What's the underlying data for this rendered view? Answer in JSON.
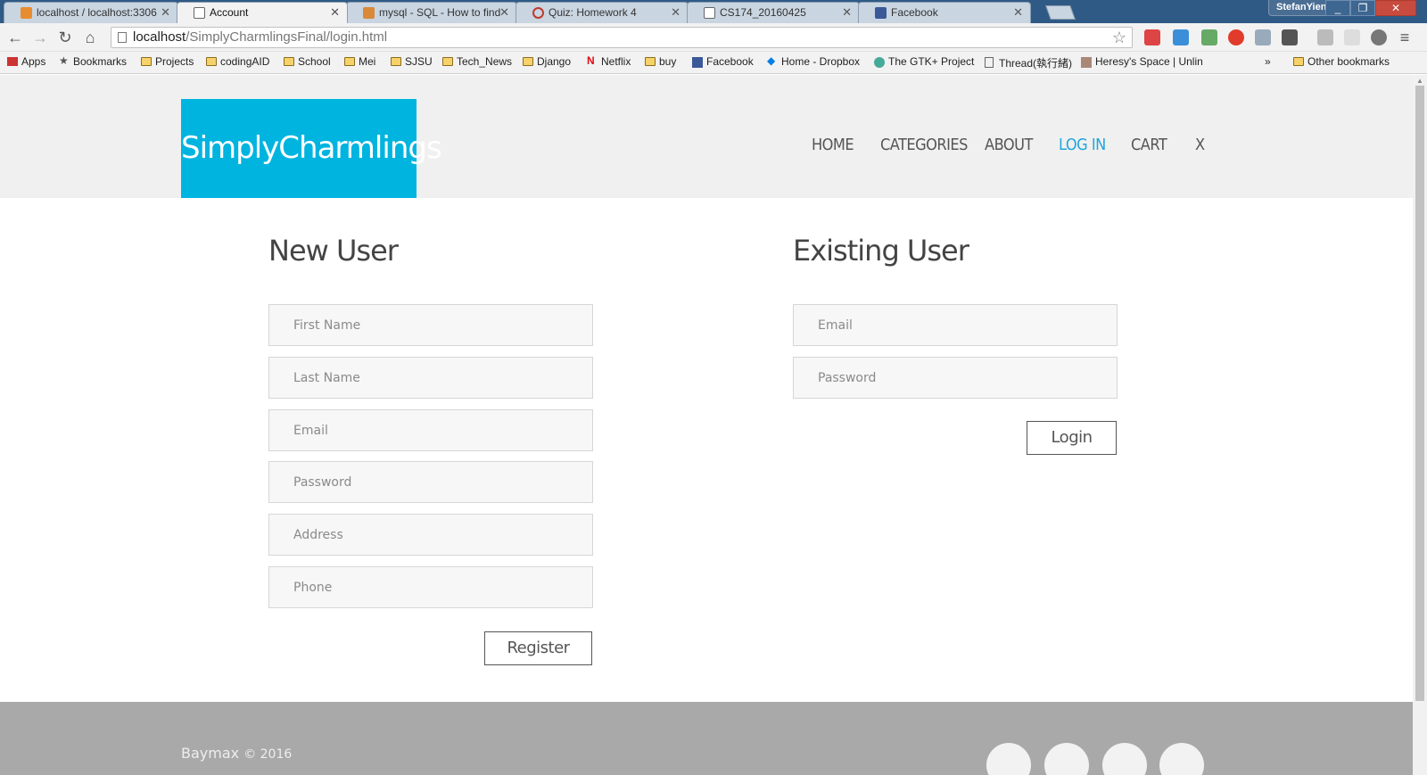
{
  "browser": {
    "tabs": [
      {
        "title": "localhost / localhost:3306"
      },
      {
        "title": "Account"
      },
      {
        "title": "mysql - SQL - How to find"
      },
      {
        "title": "Quiz: Homework 4"
      },
      {
        "title": "CS174_20160425"
      },
      {
        "title": "Facebook"
      }
    ],
    "profile_name": "StefanYien",
    "url_host": "localhost",
    "url_path": "/SimplyCharmlingsFinal/login.html",
    "bookmarks": [
      {
        "label": "Apps"
      },
      {
        "label": "Bookmarks"
      },
      {
        "label": "Projects"
      },
      {
        "label": "codingAID"
      },
      {
        "label": "School"
      },
      {
        "label": "Mei"
      },
      {
        "label": "SJSU"
      },
      {
        "label": "Tech_News"
      },
      {
        "label": "Django"
      },
      {
        "label": "Netflix"
      },
      {
        "label": "buy"
      },
      {
        "label": "Facebook"
      },
      {
        "label": "Home - Dropbox"
      },
      {
        "label": "The GTK+ Project"
      },
      {
        "label": "Thread(執行緒)"
      },
      {
        "label": "Heresy's Space | Unlin"
      }
    ],
    "overflow_chevron": "»",
    "other_bookmarks": "Other bookmarks"
  },
  "site": {
    "logo": "SimplyCharmlings",
    "nav": [
      "HOME",
      "CATEGORIES",
      "ABOUT",
      "LOG IN",
      "CART",
      "X"
    ],
    "active_nav": "LOG IN",
    "accent_color": "#00b4e0"
  },
  "new_user": {
    "title": "New User",
    "fields": [
      {
        "placeholder": "First Name"
      },
      {
        "placeholder": "Last Name"
      },
      {
        "placeholder": "Email"
      },
      {
        "placeholder": "Password"
      },
      {
        "placeholder": "Address"
      },
      {
        "placeholder": "Phone"
      }
    ],
    "button": "Register"
  },
  "existing_user": {
    "title": "Existing User",
    "fields": [
      {
        "placeholder": "Email"
      },
      {
        "placeholder": "Password"
      }
    ],
    "button": "Login"
  },
  "footer": {
    "brand": "Baymax",
    "copyright": "© 2016"
  }
}
